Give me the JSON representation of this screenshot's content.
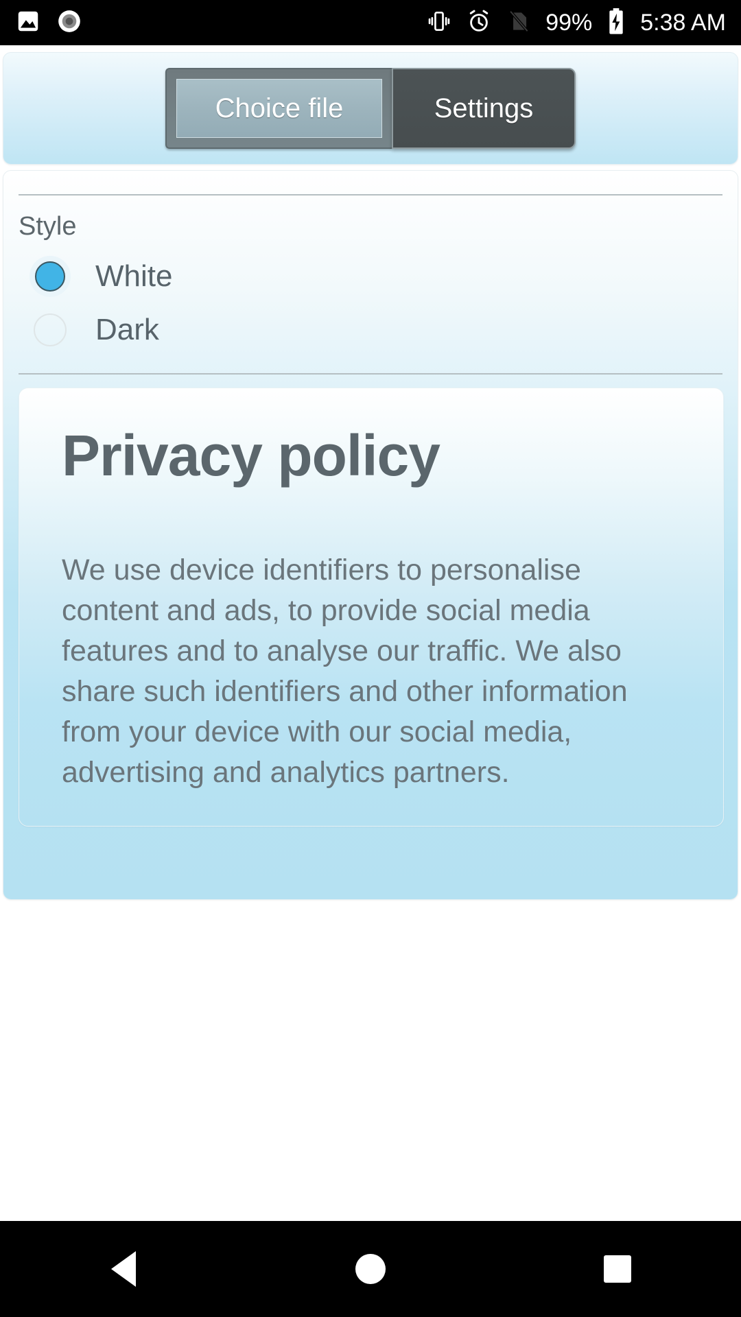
{
  "statusbar": {
    "left_icons": [
      {
        "name": "image-icon",
        "label": "photo"
      },
      {
        "name": "screen-record-icon",
        "label": "record"
      }
    ],
    "right_icons": [
      {
        "name": "vibrate-icon",
        "label": "vibrate"
      },
      {
        "name": "alarm-icon",
        "label": "alarm"
      },
      {
        "name": "no-sim-icon",
        "label": "no sim"
      }
    ],
    "battery_percent": "99%",
    "battery_state": "charging",
    "clock": "5:38 AM"
  },
  "header": {
    "tabs": [
      {
        "label": "Choice file",
        "selected": true
      },
      {
        "label": "Settings",
        "selected": false
      }
    ]
  },
  "settings": {
    "section_label": "Style",
    "options": [
      {
        "label": "White",
        "selected": true
      },
      {
        "label": "Dark",
        "selected": false
      }
    ]
  },
  "privacy": {
    "title": "Privacy policy",
    "body": "We use device identifiers to personalise content and ads, to provide social media features and to analyse our traffic. We also share such identifiers and other information from your device with our social media, advertising and analytics partners."
  },
  "navbar": {
    "back": "Back",
    "home": "Home",
    "recents": "Recents"
  },
  "colors": {
    "accent_blue": "#41b4e6",
    "page_blue": "#b5e1f2",
    "text_gray": "#5c666b",
    "tab_dark": "#4a5052",
    "statusbar_bg": "#000000"
  }
}
